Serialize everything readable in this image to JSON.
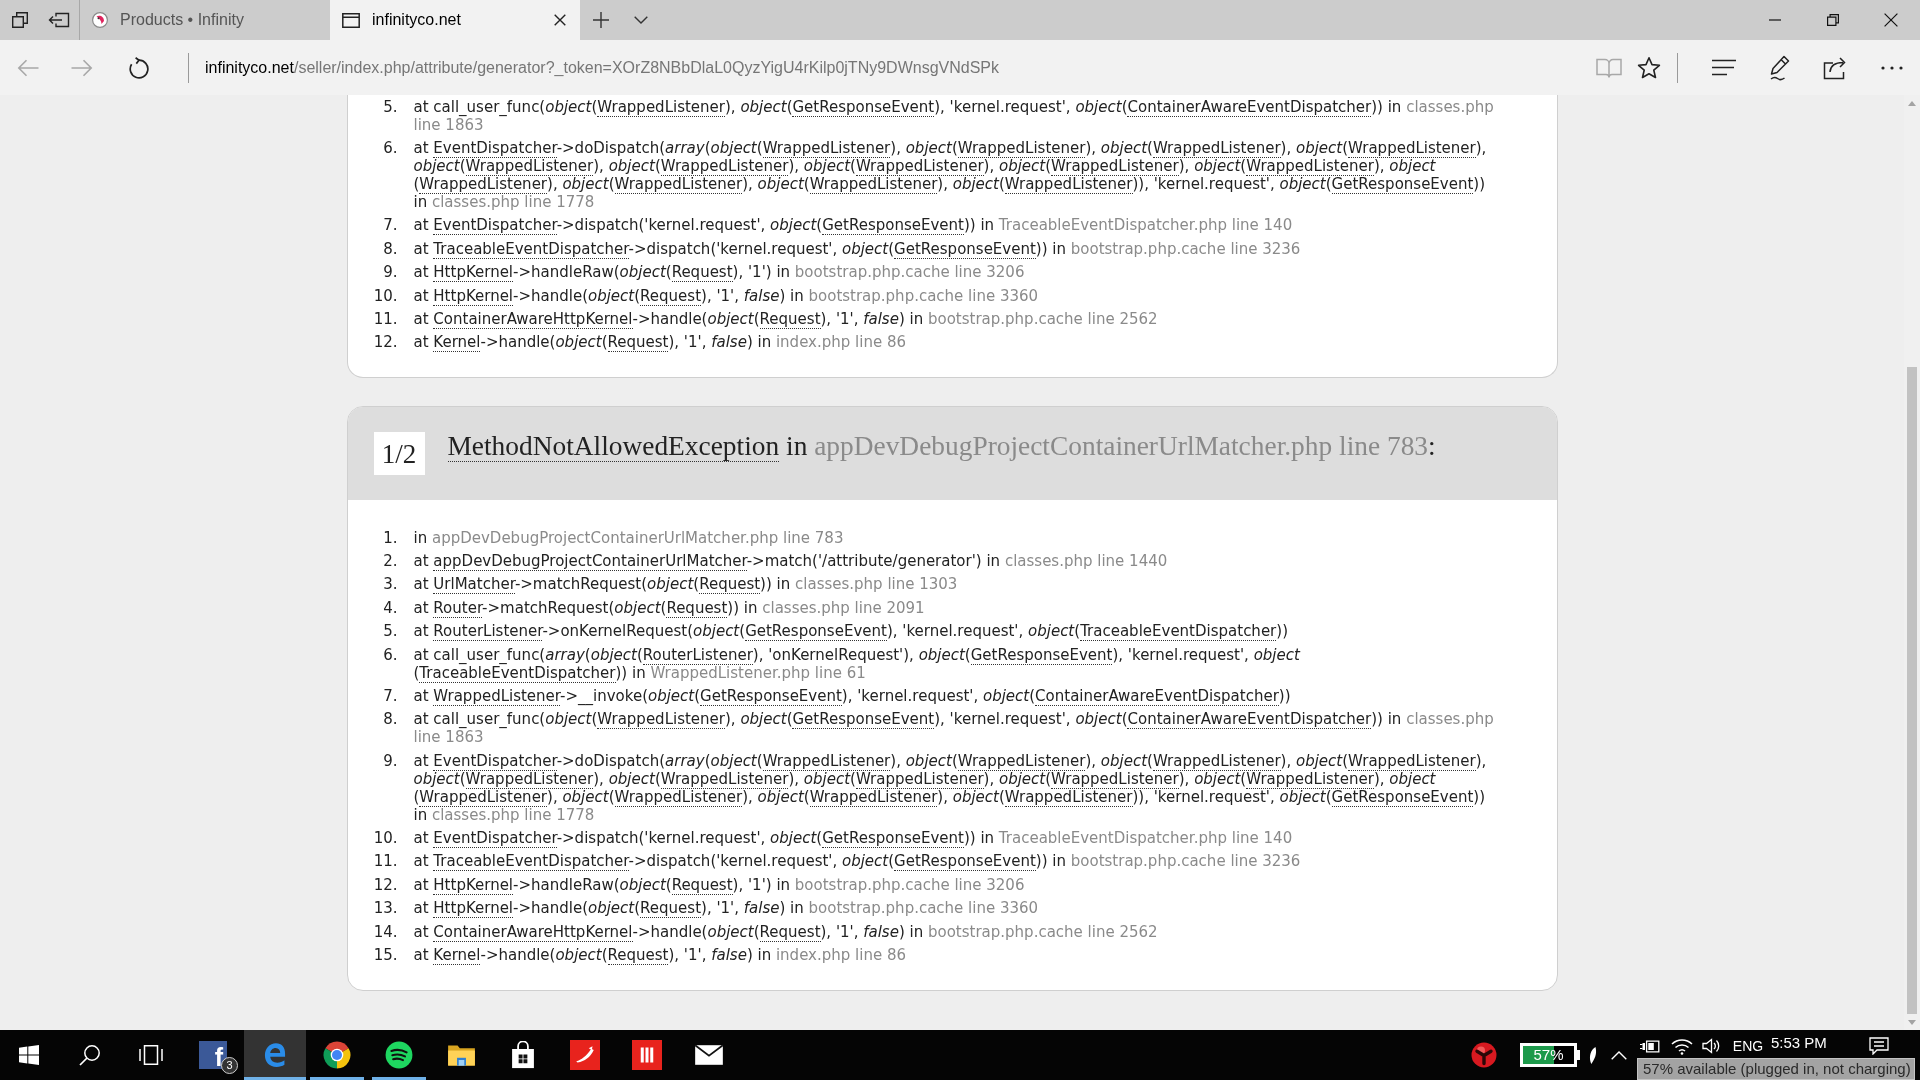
{
  "browser": {
    "tabs": [
      {
        "kind": "site-logo",
        "title": "Products • Infinity",
        "selected": false
      },
      {
        "kind": "blank-page",
        "title": "infinityco.net",
        "selected": true
      }
    ],
    "address_bar": {
      "nav_buttons": [
        {
          "kind": "back",
          "disabled": true
        },
        {
          "kind": "forward",
          "disabled": true
        },
        {
          "kind": "refresh",
          "disabled": false
        }
      ],
      "url_host": "infinityco.net",
      "url_path": "/seller/index.php/attribute/generator?_token=XOrZ8NBbDlaL0QyzYigU4rKilp0jTNy9DWnsgVNdSPk",
      "page_actions": [
        {
          "kind": "reading-view",
          "disabled": true
        },
        {
          "kind": "favorite",
          "disabled": false
        }
      ],
      "tools": [
        {
          "kind": "hub"
        },
        {
          "kind": "notes"
        },
        {
          "kind": "share"
        },
        {
          "kind": "more"
        }
      ]
    }
  },
  "page": {
    "blocks": [
      {
        "traces": [
          {
            "number": "5.",
            "segments": [
              {
                "kind": "text",
                "text": "at call_user_func(*object*("
              },
              {
                "kind": "class",
                "text": "WrappedListener"
              },
              {
                "kind": "text",
                "text": "), *object*("
              },
              {
                "kind": "class",
                "text": "GetResponseEvent"
              },
              {
                "kind": "text",
                "text": "), 'kernel.request', *object*("
              },
              {
                "kind": "class",
                "text": "ContainerAwareEventDispatcher"
              },
              {
                "kind": "text",
                "text": ")) in "
              },
              {
                "kind": "file",
                "text": "classes.php line 1863"
              }
            ]
          },
          {
            "number": "6.",
            "segments": [
              {
                "kind": "text",
                "text": "at "
              },
              {
                "kind": "class",
                "text": "EventDispatcher"
              },
              {
                "kind": "text",
                "text": "->doDispatch(*array*(*object*("
              },
              {
                "kind": "class",
                "text": "WrappedListener"
              },
              {
                "kind": "text",
                "text": "), *object*("
              },
              {
                "kind": "class",
                "text": "WrappedListener"
              },
              {
                "kind": "text",
                "text": "), *object*("
              },
              {
                "kind": "class",
                "text": "WrappedListener"
              },
              {
                "kind": "text",
                "text": "), *object*("
              },
              {
                "kind": "class",
                "text": "WrappedListener"
              },
              {
                "kind": "text",
                "text": "), *object*("
              },
              {
                "kind": "class",
                "text": "WrappedListener"
              },
              {
                "kind": "text",
                "text": "), *object*("
              },
              {
                "kind": "class",
                "text": "WrappedListener"
              },
              {
                "kind": "text",
                "text": "), *object*("
              },
              {
                "kind": "class",
                "text": "WrappedListener"
              },
              {
                "kind": "text",
                "text": "), *object*("
              },
              {
                "kind": "class",
                "text": "WrappedListener"
              },
              {
                "kind": "text",
                "text": "), *object*("
              },
              {
                "kind": "class",
                "text": "WrappedListener"
              },
              {
                "kind": "text",
                "text": "), *object*("
              },
              {
                "kind": "class",
                "text": "WrappedListener"
              },
              {
                "kind": "text",
                "text": "), *object*("
              },
              {
                "kind": "class",
                "text": "WrappedListener"
              },
              {
                "kind": "text",
                "text": "), *object*("
              },
              {
                "kind": "class",
                "text": "WrappedListener"
              },
              {
                "kind": "text",
                "text": "), *object*("
              },
              {
                "kind": "class",
                "text": "WrappedListener"
              },
              {
                "kind": "text",
                "text": ")), 'kernel.request', *object*("
              },
              {
                "kind": "class",
                "text": "GetResponseEvent"
              },
              {
                "kind": "text",
                "text": ")) in "
              },
              {
                "kind": "file",
                "text": "classes.php line 1778"
              }
            ]
          },
          {
            "number": "7.",
            "segments": [
              {
                "kind": "text",
                "text": "at "
              },
              {
                "kind": "class",
                "text": "EventDispatcher"
              },
              {
                "kind": "text",
                "text": "->dispatch('kernel.request', *object*("
              },
              {
                "kind": "class",
                "text": "GetResponseEvent"
              },
              {
                "kind": "text",
                "text": ")) in "
              },
              {
                "kind": "file",
                "text": "TraceableEventDispatcher.php line 140"
              }
            ]
          },
          {
            "number": "8.",
            "segments": [
              {
                "kind": "text",
                "text": "at "
              },
              {
                "kind": "class",
                "text": "TraceableEventDispatcher"
              },
              {
                "kind": "text",
                "text": "->dispatch('kernel.request', *object*("
              },
              {
                "kind": "class",
                "text": "GetResponseEvent"
              },
              {
                "kind": "text",
                "text": ")) in "
              },
              {
                "kind": "file",
                "text": "bootstrap.php.cache line 3236"
              }
            ]
          },
          {
            "number": "9.",
            "segments": [
              {
                "kind": "text",
                "text": "at "
              },
              {
                "kind": "class",
                "text": "HttpKernel"
              },
              {
                "kind": "text",
                "text": "->handleRaw(*object*("
              },
              {
                "kind": "class",
                "text": "Request"
              },
              {
                "kind": "text",
                "text": "), '1') in "
              },
              {
                "kind": "file",
                "text": "bootstrap.php.cache line 3206"
              }
            ]
          },
          {
            "number": "10.",
            "segments": [
              {
                "kind": "text",
                "text": "at "
              },
              {
                "kind": "class",
                "text": "HttpKernel"
              },
              {
                "kind": "text",
                "text": "->handle(*object*("
              },
              {
                "kind": "class",
                "text": "Request"
              },
              {
                "kind": "text",
                "text": "), '1', *false*) in "
              },
              {
                "kind": "file",
                "text": "bootstrap.php.cache line 3360"
              }
            ]
          },
          {
            "number": "11.",
            "segments": [
              {
                "kind": "text",
                "text": "at "
              },
              {
                "kind": "class",
                "text": "ContainerAwareHttpKernel"
              },
              {
                "kind": "text",
                "text": "->handle(*object*("
              },
              {
                "kind": "class",
                "text": "Request"
              },
              {
                "kind": "text",
                "text": "), '1', *false*) in "
              },
              {
                "kind": "file",
                "text": "bootstrap.php.cache line 2562"
              }
            ]
          },
          {
            "number": "12.",
            "segments": [
              {
                "kind": "text",
                "text": "at "
              },
              {
                "kind": "class",
                "text": "Kernel"
              },
              {
                "kind": "text",
                "text": "->handle(*object*("
              },
              {
                "kind": "class",
                "text": "Request"
              },
              {
                "kind": "text",
                "text": "), '1', *false*) in "
              },
              {
                "kind": "file",
                "text": "index.php line 86"
              }
            ]
          }
        ]
      },
      {
        "header": {
          "counter": "1/2",
          "title": [
            {
              "kind": "class",
              "text": "MethodNotAllowedException"
            },
            {
              "kind": "text",
              "text": " in "
            },
            {
              "kind": "file",
              "text": "appDevDebugProjectContainerUrlMatcher.php line 783"
            },
            {
              "kind": "text",
              "text": ":"
            }
          ]
        },
        "traces": [
          {
            "number": "1.",
            "segments": [
              {
                "kind": "text",
                "text": "in "
              },
              {
                "kind": "file",
                "text": "appDevDebugProjectContainerUrlMatcher.php line 783"
              }
            ]
          },
          {
            "number": "2.",
            "segments": [
              {
                "kind": "text",
                "text": "at "
              },
              {
                "kind": "class",
                "text": "appDevDebugProjectContainerUrlMatcher"
              },
              {
                "kind": "text",
                "text": "->match('/attribute/generator') in "
              },
              {
                "kind": "file",
                "text": "classes.php line 1440"
              }
            ]
          },
          {
            "number": "3.",
            "segments": [
              {
                "kind": "text",
                "text": "at "
              },
              {
                "kind": "class",
                "text": "UrlMatcher"
              },
              {
                "kind": "text",
                "text": "->matchRequest(*object*("
              },
              {
                "kind": "class",
                "text": "Request"
              },
              {
                "kind": "text",
                "text": ")) in "
              },
              {
                "kind": "file",
                "text": "classes.php line 1303"
              }
            ]
          },
          {
            "number": "4.",
            "segments": [
              {
                "kind": "text",
                "text": "at "
              },
              {
                "kind": "class",
                "text": "Router"
              },
              {
                "kind": "text",
                "text": "->matchRequest(*object*("
              },
              {
                "kind": "class",
                "text": "Request"
              },
              {
                "kind": "text",
                "text": ")) in "
              },
              {
                "kind": "file",
                "text": "classes.php line 2091"
              }
            ]
          },
          {
            "number": "5.",
            "segments": [
              {
                "kind": "text",
                "text": "at "
              },
              {
                "kind": "class",
                "text": "RouterListener"
              },
              {
                "kind": "text",
                "text": "->onKernelRequest(*object*("
              },
              {
                "kind": "class",
                "text": "GetResponseEvent"
              },
              {
                "kind": "text",
                "text": "), 'kernel.request', *object*("
              },
              {
                "kind": "class",
                "text": "TraceableEventDispatcher"
              },
              {
                "kind": "text",
                "text": "))"
              }
            ]
          },
          {
            "number": "6.",
            "segments": [
              {
                "kind": "text",
                "text": "at call_user_func(*array*(*object*("
              },
              {
                "kind": "class",
                "text": "RouterListener"
              },
              {
                "kind": "text",
                "text": "), 'onKernelRequest'), *object*("
              },
              {
                "kind": "class",
                "text": "GetResponseEvent"
              },
              {
                "kind": "text",
                "text": "), 'kernel.request', *object*("
              },
              {
                "kind": "class",
                "text": "TraceableEventDispatcher"
              },
              {
                "kind": "text",
                "text": ")) in "
              },
              {
                "kind": "file",
                "text": "WrappedListener.php line 61"
              }
            ]
          },
          {
            "number": "7.",
            "segments": [
              {
                "kind": "text",
                "text": "at "
              },
              {
                "kind": "class",
                "text": "WrappedListener"
              },
              {
                "kind": "text",
                "text": "->__invoke(*object*("
              },
              {
                "kind": "class",
                "text": "GetResponseEvent"
              },
              {
                "kind": "text",
                "text": "), 'kernel.request', *object*("
              },
              {
                "kind": "class",
                "text": "ContainerAwareEventDispatcher"
              },
              {
                "kind": "text",
                "text": "))"
              }
            ]
          },
          {
            "number": "8.",
            "segments": [
              {
                "kind": "text",
                "text": "at call_user_func(*object*("
              },
              {
                "kind": "class",
                "text": "WrappedListener"
              },
              {
                "kind": "text",
                "text": "), *object*("
              },
              {
                "kind": "class",
                "text": "GetResponseEvent"
              },
              {
                "kind": "text",
                "text": "), 'kernel.request', *object*("
              },
              {
                "kind": "class",
                "text": "ContainerAwareEventDispatcher"
              },
              {
                "kind": "text",
                "text": ")) in "
              },
              {
                "kind": "file",
                "text": "classes.php line 1863"
              }
            ]
          },
          {
            "number": "9.",
            "segments": [
              {
                "kind": "text",
                "text": "at "
              },
              {
                "kind": "class",
                "text": "EventDispatcher"
              },
              {
                "kind": "text",
                "text": "->doDispatch(*array*(*object*("
              },
              {
                "kind": "class",
                "text": "WrappedListener"
              },
              {
                "kind": "text",
                "text": "), *object*("
              },
              {
                "kind": "class",
                "text": "WrappedListener"
              },
              {
                "kind": "text",
                "text": "), *object*("
              },
              {
                "kind": "class",
                "text": "WrappedListener"
              },
              {
                "kind": "text",
                "text": "), *object*("
              },
              {
                "kind": "class",
                "text": "WrappedListener"
              },
              {
                "kind": "text",
                "text": "), *object*("
              },
              {
                "kind": "class",
                "text": "WrappedListener"
              },
              {
                "kind": "text",
                "text": "), *object*("
              },
              {
                "kind": "class",
                "text": "WrappedListener"
              },
              {
                "kind": "text",
                "text": "), *object*("
              },
              {
                "kind": "class",
                "text": "WrappedListener"
              },
              {
                "kind": "text",
                "text": "), *object*("
              },
              {
                "kind": "class",
                "text": "WrappedListener"
              },
              {
                "kind": "text",
                "text": "), *object*("
              },
              {
                "kind": "class",
                "text": "WrappedListener"
              },
              {
                "kind": "text",
                "text": "), *object*("
              },
              {
                "kind": "class",
                "text": "WrappedListener"
              },
              {
                "kind": "text",
                "text": "), *object*("
              },
              {
                "kind": "class",
                "text": "WrappedListener"
              },
              {
                "kind": "text",
                "text": "), *object*("
              },
              {
                "kind": "class",
                "text": "WrappedListener"
              },
              {
                "kind": "text",
                "text": "), *object*("
              },
              {
                "kind": "class",
                "text": "WrappedListener"
              },
              {
                "kind": "text",
                "text": ")), 'kernel.request', *object*("
              },
              {
                "kind": "class",
                "text": "GetResponseEvent"
              },
              {
                "kind": "text",
                "text": ")) in "
              },
              {
                "kind": "file",
                "text": "classes.php line 1778"
              }
            ]
          },
          {
            "number": "10.",
            "segments": [
              {
                "kind": "text",
                "text": "at "
              },
              {
                "kind": "class",
                "text": "EventDispatcher"
              },
              {
                "kind": "text",
                "text": "->dispatch('kernel.request', *object*("
              },
              {
                "kind": "class",
                "text": "GetResponseEvent"
              },
              {
                "kind": "text",
                "text": ")) in "
              },
              {
                "kind": "file",
                "text": "TraceableEventDispatcher.php line 140"
              }
            ]
          },
          {
            "number": "11.",
            "segments": [
              {
                "kind": "text",
                "text": "at "
              },
              {
                "kind": "class",
                "text": "TraceableEventDispatcher"
              },
              {
                "kind": "text",
                "text": "->dispatch('kernel.request', *object*("
              },
              {
                "kind": "class",
                "text": "GetResponseEvent"
              },
              {
                "kind": "text",
                "text": ")) in "
              },
              {
                "kind": "file",
                "text": "bootstrap.php.cache line 3236"
              }
            ]
          },
          {
            "number": "12.",
            "segments": [
              {
                "kind": "text",
                "text": "at "
              },
              {
                "kind": "class",
                "text": "HttpKernel"
              },
              {
                "kind": "text",
                "text": "->handleRaw(*object*("
              },
              {
                "kind": "class",
                "text": "Request"
              },
              {
                "kind": "text",
                "text": "), '1') in "
              },
              {
                "kind": "file",
                "text": "bootstrap.php.cache line 3206"
              }
            ]
          },
          {
            "number": "13.",
            "segments": [
              {
                "kind": "text",
                "text": "at "
              },
              {
                "kind": "class",
                "text": "HttpKernel"
              },
              {
                "kind": "text",
                "text": "->handle(*object*("
              },
              {
                "kind": "class",
                "text": "Request"
              },
              {
                "kind": "text",
                "text": "), '1', *false*) in "
              },
              {
                "kind": "file",
                "text": "bootstrap.php.cache line 3360"
              }
            ]
          },
          {
            "number": "14.",
            "segments": [
              {
                "kind": "text",
                "text": "at "
              },
              {
                "kind": "class",
                "text": "ContainerAwareHttpKernel"
              },
              {
                "kind": "text",
                "text": "->handle(*object*("
              },
              {
                "kind": "class",
                "text": "Request"
              },
              {
                "kind": "text",
                "text": "), '1', *false*) in "
              },
              {
                "kind": "file",
                "text": "bootstrap.php.cache line 2562"
              }
            ]
          },
          {
            "number": "15.",
            "segments": [
              {
                "kind": "text",
                "text": "at "
              },
              {
                "kind": "class",
                "text": "Kernel"
              },
              {
                "kind": "text",
                "text": "->handle(*object*("
              },
              {
                "kind": "class",
                "text": "Request"
              },
              {
                "kind": "text",
                "text": "), '1', *false*) in "
              },
              {
                "kind": "file",
                "text": "index.php line 86"
              }
            ]
          }
        ]
      }
    ]
  },
  "taskbar": {
    "buttons": [
      {
        "kind": "start"
      },
      {
        "kind": "search"
      },
      {
        "kind": "task-view"
      }
    ],
    "apps": [
      {
        "kind": "letter-tile",
        "logo_text": "f",
        "badge": "3",
        "running": false,
        "selected": false
      },
      {
        "kind": "e-logo",
        "running": true,
        "selected": true
      },
      {
        "kind": "segmented-circle",
        "running": true,
        "selected": false
      },
      {
        "kind": "sound-waves",
        "running": true,
        "selected": false
      },
      {
        "kind": "folder",
        "running": false,
        "selected": false
      },
      {
        "kind": "bag",
        "running": false,
        "selected": false
      },
      {
        "kind": "swoosh-tile",
        "running": false,
        "selected": false
      },
      {
        "kind": "bars-tile",
        "running": false,
        "selected": false
      },
      {
        "kind": "envelope",
        "running": false,
        "selected": false
      }
    ],
    "tray": [
      {
        "kind": "emblem"
      },
      {
        "kind": "battery",
        "text": "57%"
      },
      {
        "kind": "feather"
      },
      {
        "kind": "chevron"
      },
      {
        "kind": "plug-battery"
      },
      {
        "kind": "wifi"
      },
      {
        "kind": "speaker"
      },
      {
        "kind": "language",
        "text": "ENG"
      },
      {
        "kind": "clock",
        "text": "5:53 PM"
      },
      {
        "kind": "message"
      }
    ],
    "tooltip": "57% available (plugged in, not charging)"
  }
}
